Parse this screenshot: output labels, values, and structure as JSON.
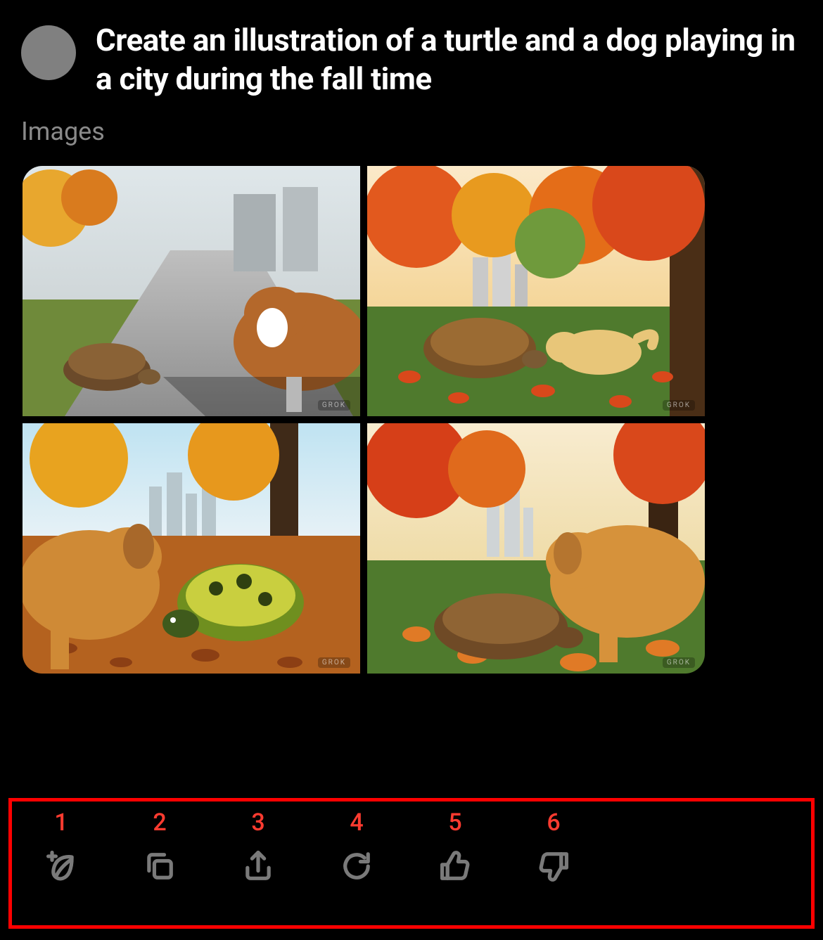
{
  "header": {
    "prompt": "Create an illustration of a turtle and a dog playing in a city during the fall time"
  },
  "section_label": "Images",
  "images": {
    "watermark": "GROK",
    "tiles": [
      {
        "alt": "turtle-and-collie-on-sidewalk-fall"
      },
      {
        "alt": "turtle-and-yellow-lab-in-city-park-fall"
      },
      {
        "alt": "golden-retriever-and-green-turtle-fall-leaves"
      },
      {
        "alt": "golden-retriever-and-tortoise-city-park-fall"
      }
    ]
  },
  "actions": [
    {
      "index": "1",
      "icon": "new-leaf-icon",
      "name": "create-new-button"
    },
    {
      "index": "2",
      "icon": "copy-icon",
      "name": "copy-button"
    },
    {
      "index": "3",
      "icon": "share-icon",
      "name": "share-button"
    },
    {
      "index": "4",
      "icon": "regenerate-icon",
      "name": "regenerate-button"
    },
    {
      "index": "5",
      "icon": "thumbs-up-icon",
      "name": "thumbs-up-button"
    },
    {
      "index": "6",
      "icon": "thumbs-down-icon",
      "name": "thumbs-down-button"
    }
  ],
  "colors": {
    "background": "#000000",
    "text_primary": "#ffffff",
    "text_secondary": "#8a8a8a",
    "icon": "#7a7a7a",
    "accent_red": "#ff3b30",
    "highlight_border": "#ff0000",
    "avatar": "#808080"
  }
}
